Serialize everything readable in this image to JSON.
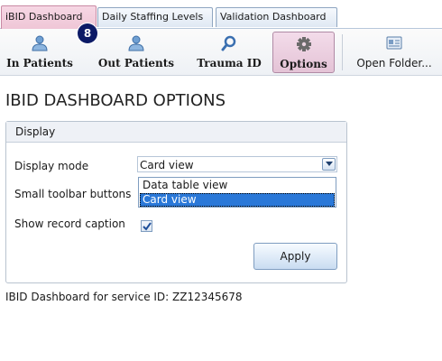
{
  "tabs": [
    {
      "label": "iBID Dashboard",
      "active": true
    },
    {
      "label": "Daily Staffing Levels",
      "active": false
    },
    {
      "label": "Validation Dashboard",
      "active": false
    }
  ],
  "badge": {
    "count": "8"
  },
  "toolbar": {
    "in_patients": {
      "label": "In Patients",
      "icon": "user-icon"
    },
    "out_patients": {
      "label": "Out Patients",
      "icon": "user-icon"
    },
    "trauma_id": {
      "label": "Trauma ID",
      "icon": "search-icon"
    },
    "options": {
      "label": "Options",
      "icon": "gear-icon",
      "selected": true
    },
    "open_folder": {
      "label": "Open Folder...",
      "icon": "folder-card-icon"
    }
  },
  "page": {
    "title": "IBID DASHBOARD OPTIONS"
  },
  "display": {
    "group_title": "Display",
    "display_mode_label": "Display mode",
    "display_mode_value": "Card view",
    "display_mode_options": [
      "Data table view",
      "Card view"
    ],
    "small_toolbar_label": "Small toolbar buttons",
    "show_caption_label": "Show record caption",
    "show_caption_checked": true,
    "apply_label": "Apply"
  },
  "footer": {
    "text": "IBID Dashboard for service ID: ZZ12345678"
  },
  "colors": {
    "accent_tab": "#efc6d6",
    "badge": "#0c1a66",
    "selection": "#2a78d8"
  }
}
